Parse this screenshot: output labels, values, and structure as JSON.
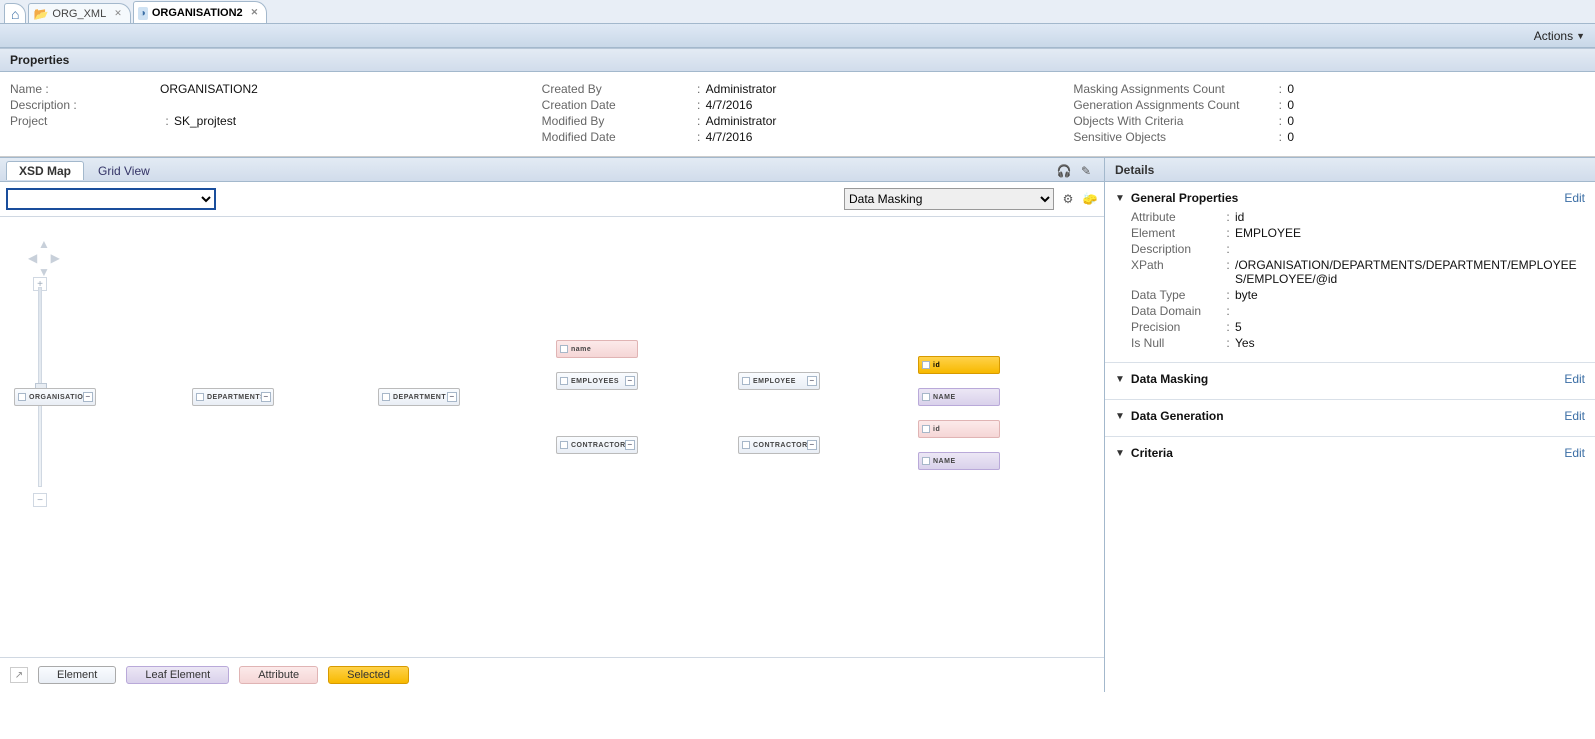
{
  "tabs": {
    "home": "",
    "org_xml": "ORG_XML",
    "org2": "ORGANISATION2"
  },
  "toolbar": {
    "actions": "Actions"
  },
  "propertiesHeader": "Properties",
  "properties": {
    "col1": {
      "nameLabel": "Name :",
      "nameValue": "ORGANISATION2",
      "descLabel": "Description :",
      "descValue": "",
      "projLabel": "Project",
      "projValue": "SK_projtest"
    },
    "col2": {
      "createdByLabel": "Created By",
      "createdByValue": "Administrator",
      "creationDateLabel": "Creation Date",
      "creationDateValue": "4/7/2016",
      "modifiedByLabel": "Modified By",
      "modifiedByValue": "Administrator",
      "modifiedDateLabel": "Modified Date",
      "modifiedDateValue": "4/7/2016"
    },
    "col3": {
      "maskCountLabel": "Masking Assignments Count",
      "maskCountValue": "0",
      "genCountLabel": "Generation Assignments Count",
      "genCountValue": "0",
      "critCountLabel": "Objects With Criteria",
      "critCountValue": "0",
      "sensLabel": "Sensitive Objects",
      "sensValue": "0"
    }
  },
  "viewTabs": {
    "xsd": "XSD Map",
    "grid": "Grid View"
  },
  "searchRow": {
    "dropdownValue": "",
    "modeValue": "Data Masking"
  },
  "nodes": {
    "organisation": "ORGANISATION",
    "departments": "DEPARTMENTS",
    "department": "DEPARTMENT",
    "name": "name",
    "employees": "EMPLOYEES",
    "contractors": "CONTRACTORS",
    "employee": "EMPLOYEE",
    "contractor": "CONTRACTOR",
    "id": "id",
    "NAME": "NAME"
  },
  "legend": {
    "element": "Element",
    "leaf": "Leaf Element",
    "attribute": "Attribute",
    "selected": "Selected"
  },
  "details": {
    "header": "Details",
    "general": {
      "title": "General Properties",
      "edit": "Edit",
      "rows": {
        "attributeLabel": "Attribute",
        "attributeValue": "id",
        "elementLabel": "Element",
        "elementValue": "EMPLOYEE",
        "descLabel": "Description",
        "descValue": "",
        "xpathLabel": "XPath",
        "xpathValue": "/ORGANISATION/DEPARTMENTS/DEPARTMENT/EMPLOYEES/EMPLOYEE/@id",
        "typeLabel": "Data Type",
        "typeValue": "byte",
        "domainLabel": "Data Domain",
        "domainValue": "",
        "precLabel": "Precision",
        "precValue": "5",
        "nullLabel": "Is Null",
        "nullValue": "Yes"
      }
    },
    "masking": {
      "title": "Data Masking",
      "edit": "Edit"
    },
    "generation": {
      "title": "Data Generation",
      "edit": "Edit"
    },
    "criteria": {
      "title": "Criteria",
      "edit": "Edit"
    }
  }
}
